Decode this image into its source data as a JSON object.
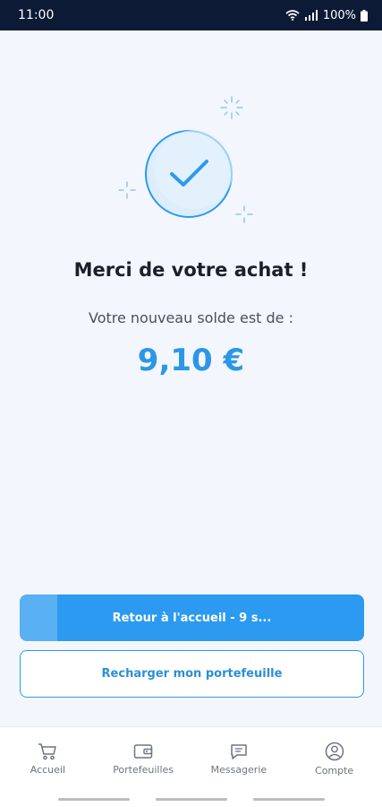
{
  "status_bar": {
    "time": "11:00",
    "battery": "100%",
    "icons": [
      "wifi-icon",
      "signal-icon",
      "battery-icon"
    ]
  },
  "content": {
    "title": "Merci de votre achat !",
    "balance_label": "Votre nouveau solde est de :",
    "balance_amount": "9,10 €"
  },
  "actions": {
    "primary_label": "Retour à l'accueil - 9 s...",
    "primary_progress": 0.11,
    "secondary_label": "Recharger mon portefeuille"
  },
  "nav": {
    "items": [
      {
        "label": "Accueil",
        "icon": "cart-icon"
      },
      {
        "label": "Portefeuilles",
        "icon": "wallet-icon"
      },
      {
        "label": "Messagerie",
        "icon": "chat-icon"
      },
      {
        "label": "Compte",
        "icon": "account-icon"
      }
    ]
  },
  "colors": {
    "accent": "#2b9af0",
    "status_bar": "#0d1a36",
    "background": "#f3f7fd"
  }
}
